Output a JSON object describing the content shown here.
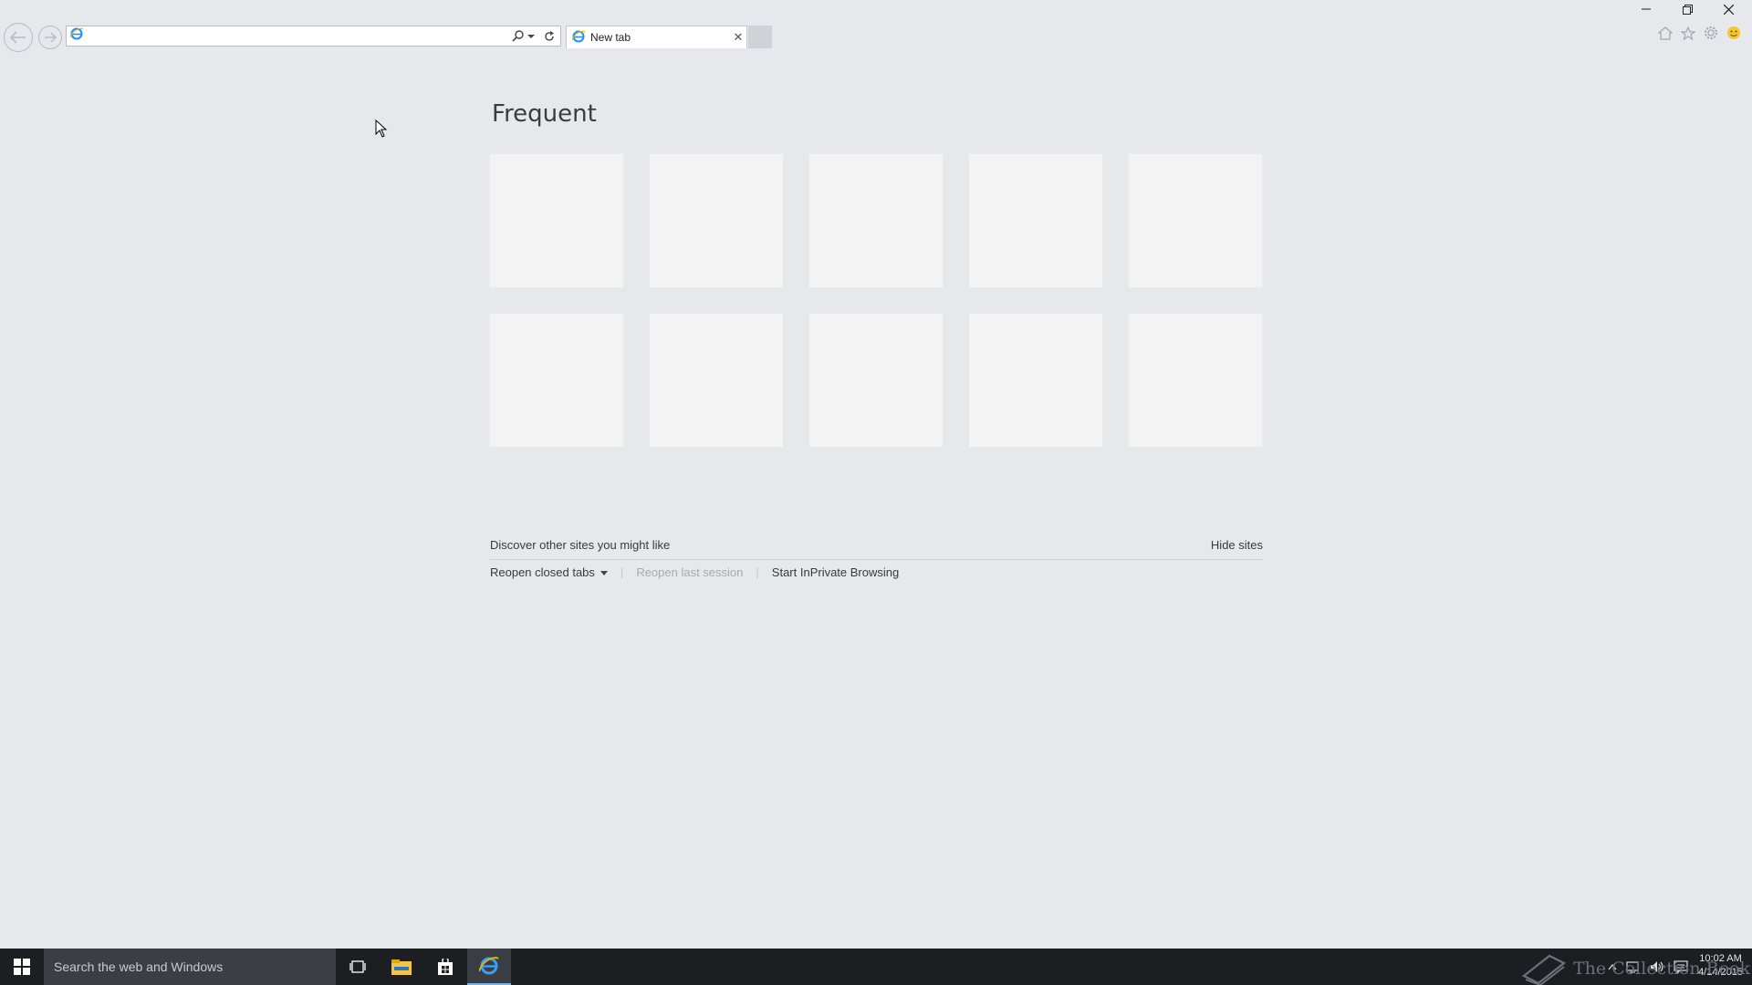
{
  "window": {
    "caption": {
      "minimize_icon": "minimize-icon",
      "restore_icon": "restore-icon",
      "close_icon": "close-icon"
    }
  },
  "toolbar": {
    "back_icon": "back-arrow-icon",
    "forward_icon": "forward-arrow-icon",
    "address": {
      "value": "",
      "placeholder": ""
    },
    "address_icons": [
      "search-icon",
      "dropdown-icon",
      "refresh-icon"
    ],
    "right_icons": [
      "home-icon",
      "favorites-star-icon",
      "gear-icon",
      "smiley-feedback-icon"
    ]
  },
  "tab": {
    "label": "New tab",
    "close": "✕"
  },
  "content": {
    "title": "Frequent",
    "tile_count": 10,
    "discover_text": "Discover other sites you might like",
    "hide_sites": "Hide sites",
    "reopen_closed_tabs": "Reopen closed tabs",
    "reopen_last_session": "Reopen last session",
    "start_inprivate": "Start InPrivate Browsing"
  },
  "taskbar": {
    "search_placeholder": "Search the web and Windows",
    "pinned": [
      "task-view-icon",
      "file-explorer-icon",
      "store-icon",
      "internet-explorer-icon"
    ],
    "active_app": "internet-explorer-icon",
    "watermark_text": "The Collection Book",
    "tray_icons": [
      "chevron-up-icon",
      "network-icon",
      "volume-icon",
      "action-center-icon"
    ],
    "time": "10:02 AM",
    "date": "4/14/2015"
  },
  "colors": {
    "page_bg": "#e6e8eb",
    "tile_bg": "#f3f3f3",
    "taskbar_bg": "#1c1e22",
    "accent": "#1e90ff"
  }
}
